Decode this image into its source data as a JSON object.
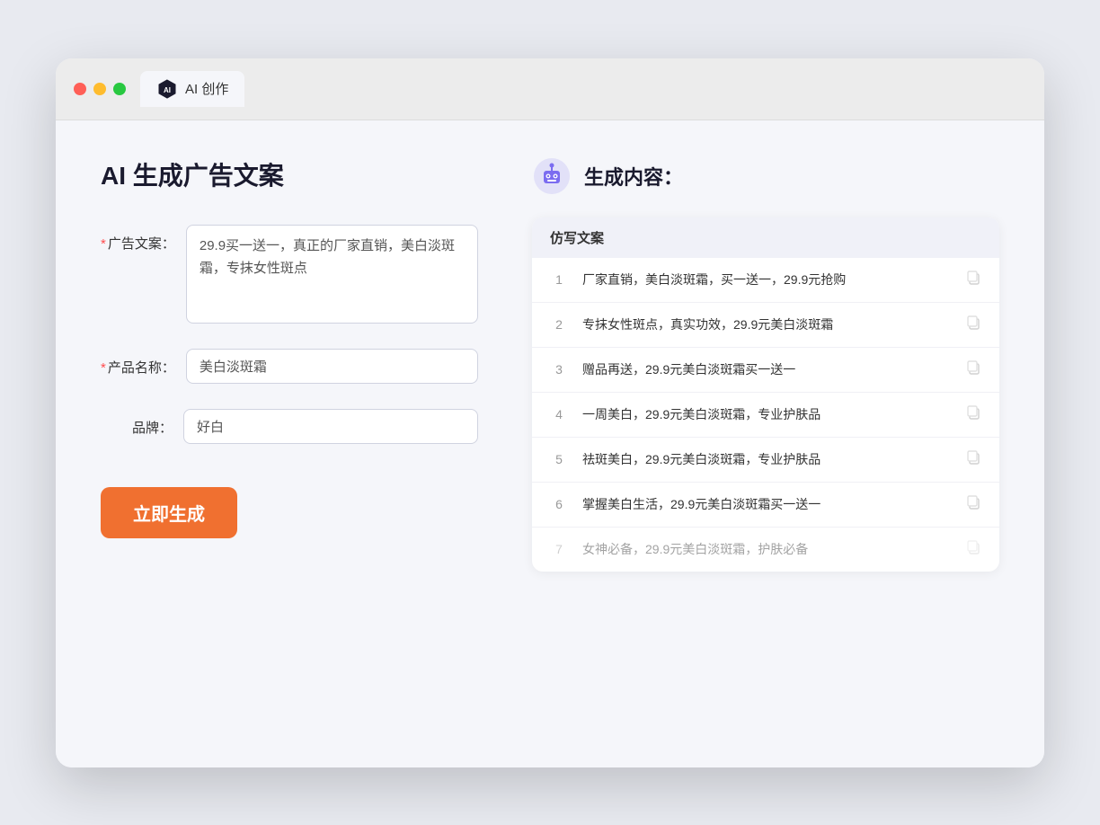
{
  "browser": {
    "tab_label": "AI 创作"
  },
  "page": {
    "title": "AI 生成广告文案",
    "result_title": "生成内容："
  },
  "form": {
    "ad_label": "广告文案：",
    "ad_required": "*",
    "ad_value": "29.9买一送一，真正的厂家直销，美白淡斑霜，专抹女性斑点",
    "product_label": "产品名称：",
    "product_required": "*",
    "product_value": "美白淡斑霜",
    "brand_label": "品牌：",
    "brand_value": "好白",
    "button_label": "立即生成"
  },
  "results": {
    "header": "仿写文案",
    "items": [
      {
        "num": "1",
        "text": "厂家直销，美白淡斑霜，买一送一，29.9元抢购",
        "dimmed": false
      },
      {
        "num": "2",
        "text": "专抹女性斑点，真实功效，29.9元美白淡斑霜",
        "dimmed": false
      },
      {
        "num": "3",
        "text": "赠品再送，29.9元美白淡斑霜买一送一",
        "dimmed": false
      },
      {
        "num": "4",
        "text": "一周美白，29.9元美白淡斑霜，专业护肤品",
        "dimmed": false
      },
      {
        "num": "5",
        "text": "祛斑美白，29.9元美白淡斑霜，专业护肤品",
        "dimmed": false
      },
      {
        "num": "6",
        "text": "掌握美白生活，29.9元美白淡斑霜买一送一",
        "dimmed": false
      },
      {
        "num": "7",
        "text": "女神必备，29.9元美白淡斑霜，护肤必备",
        "dimmed": true
      }
    ]
  },
  "colors": {
    "accent_orange": "#f07030",
    "accent_purple": "#7b6cf0",
    "required_red": "#ff4d4f"
  }
}
